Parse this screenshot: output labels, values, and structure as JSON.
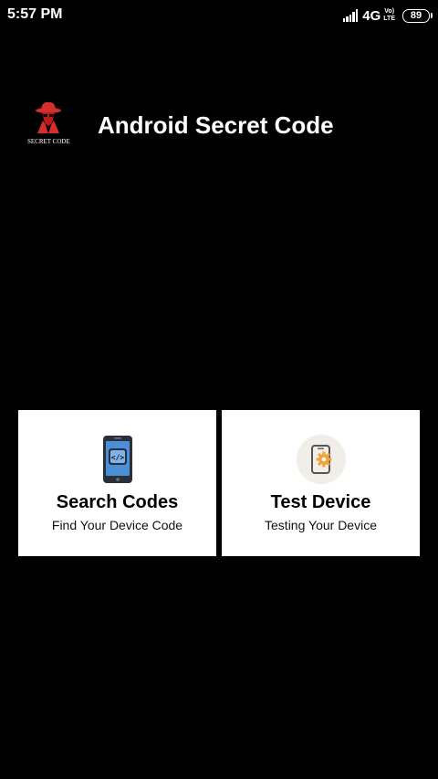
{
  "status_bar": {
    "time": "5:57 PM",
    "network": "4G",
    "volte_top": "Vo)",
    "volte_bottom": "LTE",
    "battery": "89",
    "icons": [
      "signal-icon",
      "volte-icon",
      "battery-icon"
    ]
  },
  "header": {
    "logo_text": "SECRET CODE",
    "title": "Android Secret Code",
    "logo_icon": "spy-hat-icon"
  },
  "cards": [
    {
      "title": "Search Codes",
      "subtitle": "Find Your Device Code",
      "icon": "phone-code-icon"
    },
    {
      "title": "Test Device",
      "subtitle": "Testing Your Device",
      "icon": "phone-gear-icon"
    }
  ],
  "colors": {
    "background": "#000000",
    "card_background": "#ffffff",
    "logo_red": "#d32f2f",
    "phone_blue": "#4a90d9",
    "gear_orange": "#f2a33a"
  }
}
